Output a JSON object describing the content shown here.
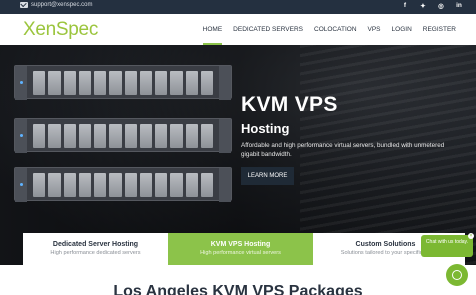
{
  "topbar": {
    "email": "support@xenspec.com",
    "email_icon": "envelope-icon",
    "social": [
      {
        "icon": "facebook-icon",
        "glyph": "f"
      },
      {
        "icon": "twitter-icon",
        "glyph": "✦"
      },
      {
        "icon": "instagram-icon",
        "glyph": "◎"
      },
      {
        "icon": "linkedin-icon",
        "glyph": "in"
      }
    ]
  },
  "nav": {
    "logo": "XenSpec",
    "items": [
      "HOME",
      "DEDICATED SERVERS",
      "COLOCATION",
      "VPS",
      "LOGIN",
      "REGISTER"
    ],
    "active_index": 0
  },
  "hero": {
    "title": "KVM VPS",
    "subtitle": "Hosting",
    "description": "Affordable and high performance virtual servers, bundled with unmetered gigabit bandwidth.",
    "button": "LEARN MORE"
  },
  "tabs": [
    {
      "title": "Dedicated Server Hosting",
      "subtitle": "High performance dedicated servers"
    },
    {
      "title": "KVM VPS Hosting",
      "subtitle": "High performance virtual servers"
    },
    {
      "title": "Custom Solutions",
      "subtitle": "Solutions tailored to your specific ne"
    }
  ],
  "section": {
    "title": "Los Angeles KVM VPS Packages"
  },
  "chat": {
    "bubble": "Chat with us today.",
    "close": "×"
  },
  "colors": {
    "brand_green": "#8cc34a",
    "topbar": "#243040",
    "text_dark": "#2a3340"
  }
}
